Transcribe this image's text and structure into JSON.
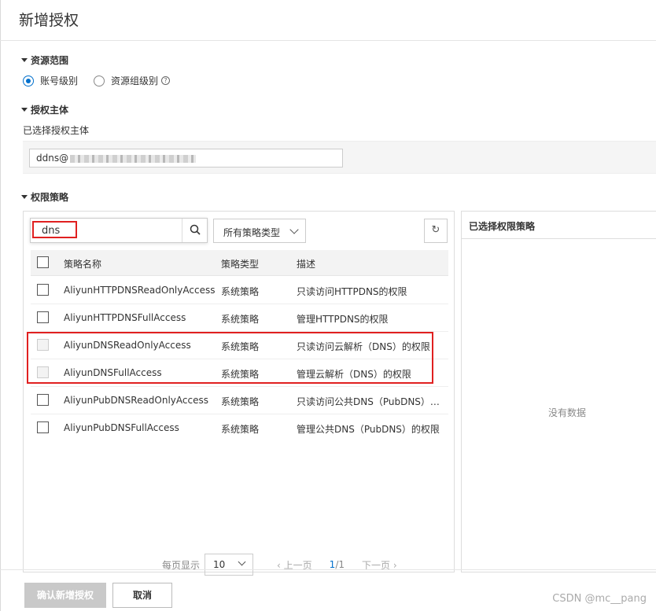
{
  "dialog": {
    "title": "新增授权"
  },
  "resource_scope": {
    "heading": "资源范围",
    "options": [
      {
        "label": "账号级别",
        "checked": true
      },
      {
        "label": "资源组级别",
        "checked": false
      }
    ],
    "help_icon": "question-circle-icon"
  },
  "principal": {
    "heading": "授权主体",
    "selected_label": "已选择授权主体",
    "value": "ddns@"
  },
  "policy": {
    "heading": "权限策略",
    "search_value": "dns",
    "type_filter": "所有策略类型",
    "refresh_icon": "↻",
    "columns": {
      "name": "策略名称",
      "type": "策略类型",
      "desc": "描述"
    },
    "rows": [
      {
        "name": "AliyunHTTPDNSReadOnlyAccess",
        "type": "系统策略",
        "desc": "只读访问HTTPDNS的权限",
        "disabled": false
      },
      {
        "name": "AliyunHTTPDNSFullAccess",
        "type": "系统策略",
        "desc": "管理HTTPDNS的权限",
        "disabled": false
      },
      {
        "name": "AliyunDNSReadOnlyAccess",
        "type": "系统策略",
        "desc": "只读访问云解析（DNS）的权限",
        "disabled": true
      },
      {
        "name": "AliyunDNSFullAccess",
        "type": "系统策略",
        "desc": "管理云解析（DNS）的权限",
        "disabled": true
      },
      {
        "name": "AliyunPubDNSReadOnlyAccess",
        "type": "系统策略",
        "desc": "只读访问公共DNS（PubDNS）…",
        "disabled": false
      },
      {
        "name": "AliyunPubDNSFullAccess",
        "type": "系统策略",
        "desc": "管理公共DNS（PubDNS）的权限",
        "disabled": false
      }
    ],
    "pager": {
      "page_size_label": "每页显示",
      "page_size": "10",
      "prev": "上一页",
      "current": "1",
      "total": "/1",
      "next": "下一页",
      "prev_icon": "‹",
      "next_icon": "›"
    }
  },
  "selected_panel": {
    "heading": "已选择权限策略",
    "empty": "没有数据"
  },
  "footer": {
    "confirm": "确认新增授权",
    "cancel": "取消",
    "watermark": "CSDN @mc__pang"
  },
  "colors": {
    "accent": "#0070cc",
    "highlight": "#e02020"
  }
}
